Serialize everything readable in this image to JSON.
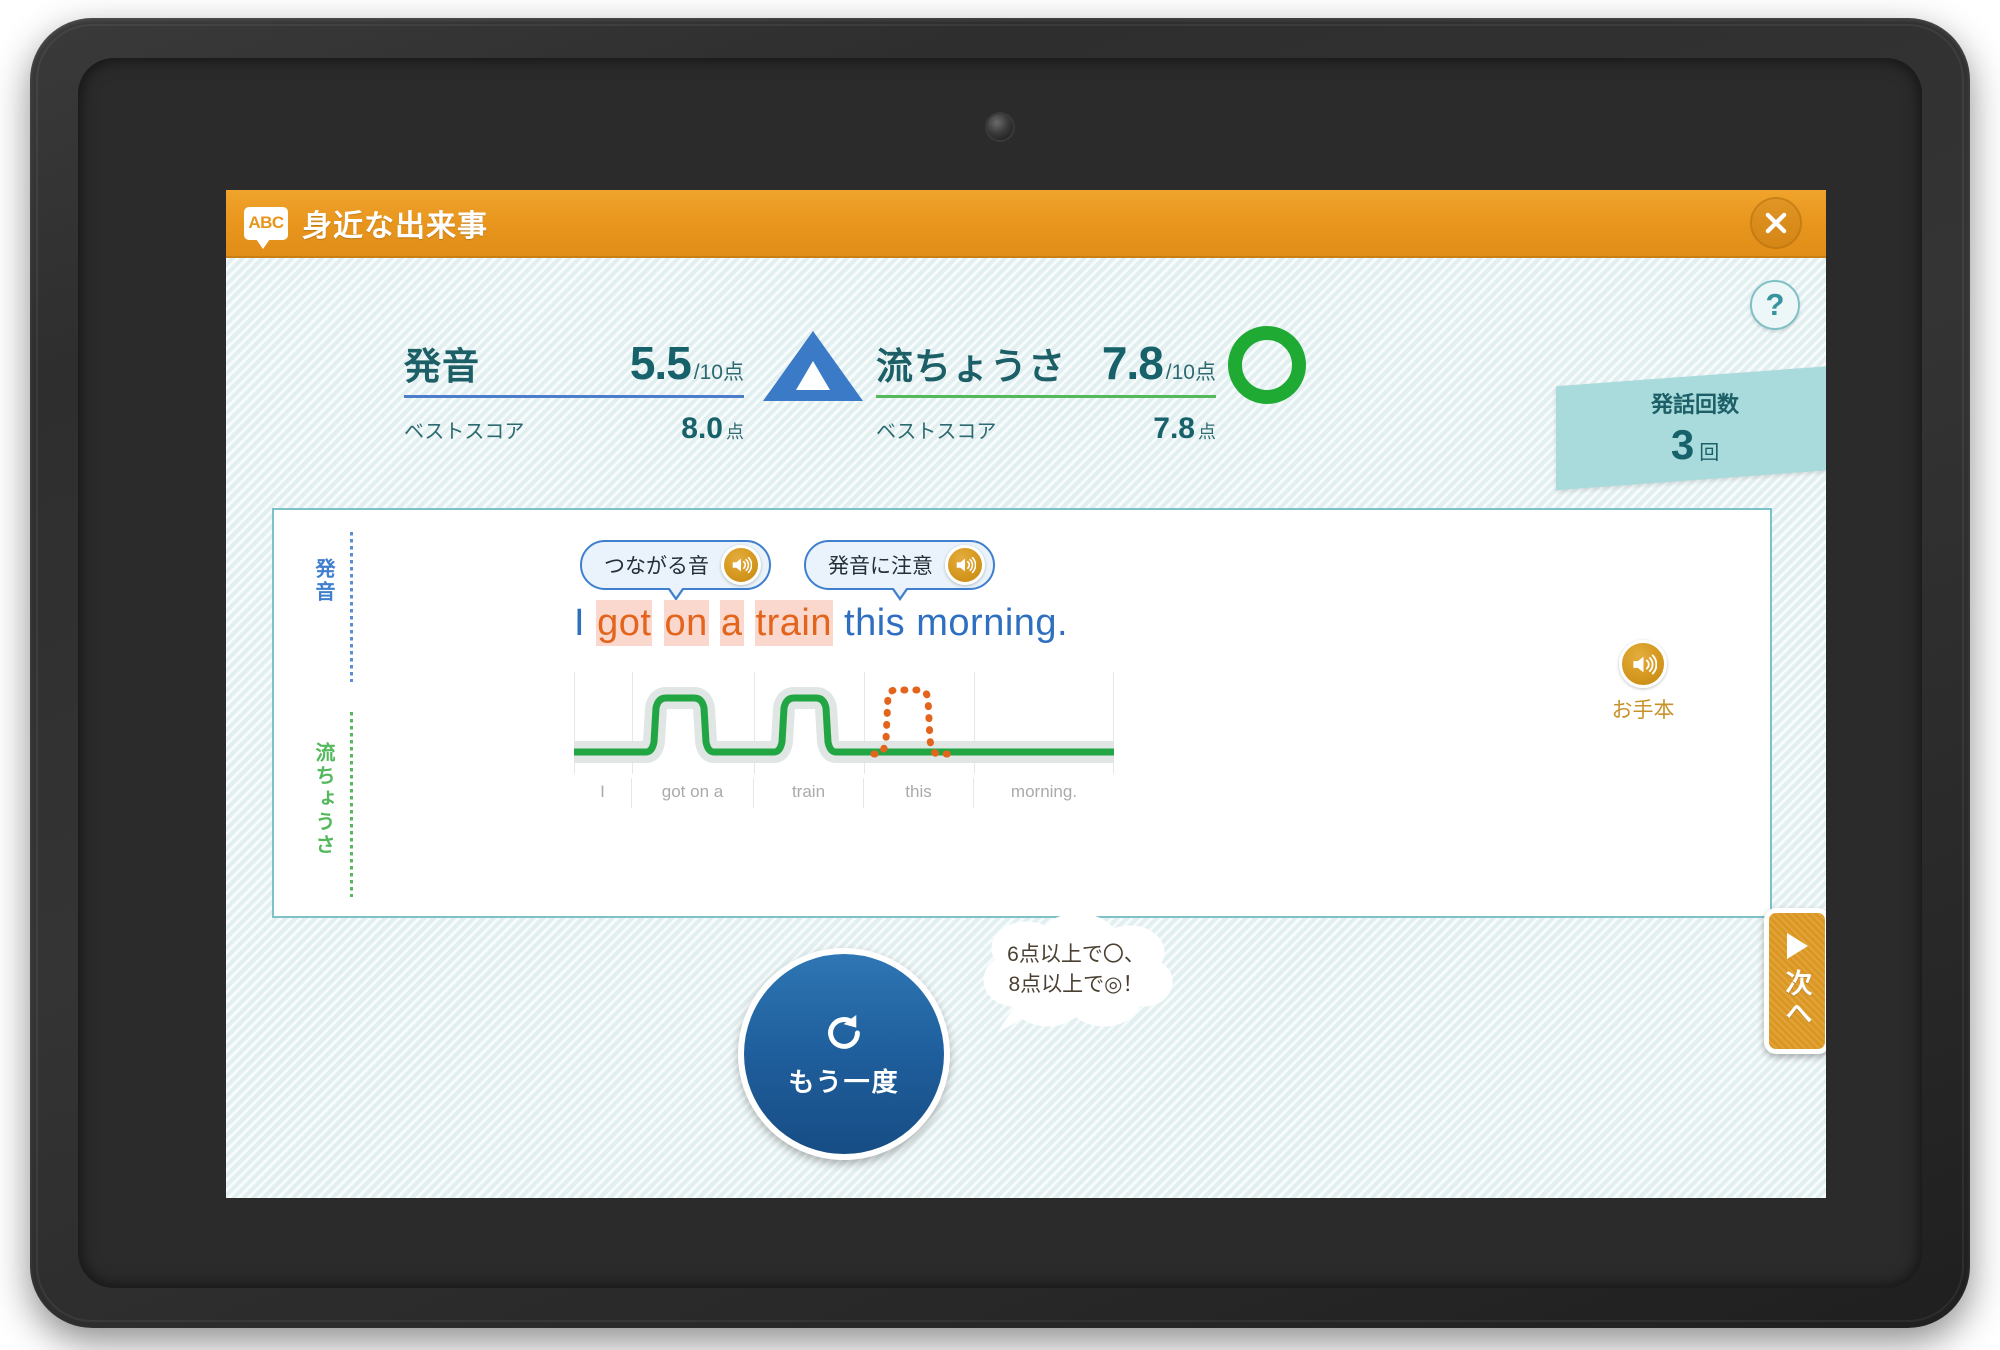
{
  "titlebar": {
    "icon_label": "ABC",
    "title": "身近な出来事",
    "close_icon": "close-icon"
  },
  "help_button": {
    "label": "?"
  },
  "scores": {
    "pronunciation": {
      "label": "発音",
      "value": "5.5",
      "denominator": "/10点",
      "grade_icon": "triangle",
      "grade_color": "#3a7ac7",
      "rule_color": "#4b7dc8",
      "best_label": "ベストスコア",
      "best_value": "8.0",
      "best_unit": "点"
    },
    "fluency": {
      "label": "流ちょうさ",
      "value": "7.8",
      "denominator": "/10点",
      "grade_icon": "circle",
      "grade_color": "#1eaa33",
      "rule_color": "#54b85c",
      "best_label": "ベストスコア",
      "best_value": "7.8",
      "best_unit": "点"
    }
  },
  "utterance": {
    "label": "発話回数",
    "count": "3",
    "unit": "回"
  },
  "analysis": {
    "side_labels": {
      "pronunciation": "発音",
      "fluency": "流ちょうさ"
    },
    "tips": [
      {
        "text": "つながる音",
        "icon": "speaker-icon"
      },
      {
        "text": "発音に注意",
        "icon": "speaker-icon"
      }
    ],
    "sentence_tokens": [
      {
        "text": "I",
        "style": "blue"
      },
      {
        "text": "got",
        "style": "highlight"
      },
      {
        "text": "on",
        "style": "highlight"
      },
      {
        "text": "a",
        "style": "highlight"
      },
      {
        "text": "train",
        "style": "highlight"
      },
      {
        "text": "this",
        "style": "blue"
      },
      {
        "text": "morning.",
        "style": "blue"
      }
    ],
    "model_audio": {
      "label": "お手本",
      "icon": "speaker-icon"
    }
  },
  "chart_data": {
    "type": "line",
    "title": "",
    "xlabel": "",
    "ylabel": "",
    "categories": [
      "I",
      "got on a",
      "train",
      "this",
      "morning."
    ],
    "series": [
      {
        "name": "model",
        "color": "#22a644",
        "style": "solid",
        "values": [
          0,
          1,
          1,
          0,
          0
        ]
      },
      {
        "name": "learner",
        "color": "#e2641d",
        "style": "dotted",
        "values": [
          null,
          null,
          null,
          1,
          null
        ]
      }
    ],
    "grid": true,
    "legend": "none",
    "ylim": [
      0,
      1
    ]
  },
  "controls": {
    "retry": {
      "label": "もう一度",
      "icon": "replay-icon"
    },
    "next": {
      "label": "次へ",
      "icon": "play-icon"
    },
    "hint_bubble": {
      "line1": "6点以上で〇、",
      "line2": "8点以上で◎！"
    }
  }
}
